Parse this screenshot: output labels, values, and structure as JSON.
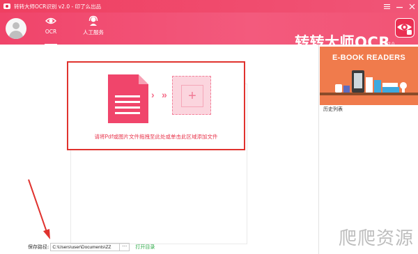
{
  "window": {
    "title": "转转大师OCR识别 v2.0 - 印了么出品",
    "controls": [
      "menu-icon",
      "minimize-icon",
      "close-icon"
    ]
  },
  "header": {
    "nav": [
      {
        "label": "OCR",
        "icon": "eye-icon"
      },
      {
        "label": "人工服务",
        "icon": "headset-icon"
      }
    ],
    "brand": "转转大师OCR",
    "version": "V2.0"
  },
  "main": {
    "drop_hint": "请将Pdf或图片文件拖拽至此处或单击此区域添加文件"
  },
  "save": {
    "label": "保存路径:",
    "path": "C:\\Users\\user\\Documents\\ZZ",
    "more": "···",
    "open_dir": "打开目录"
  },
  "side": {
    "banner_title": "E-BOOK READERS",
    "history_label": "历史列表"
  },
  "watermark": "爬爬资源",
  "colors": {
    "accent": "#f0456b",
    "drop_border": "#e0322e",
    "open_dir": "#2aa844"
  }
}
